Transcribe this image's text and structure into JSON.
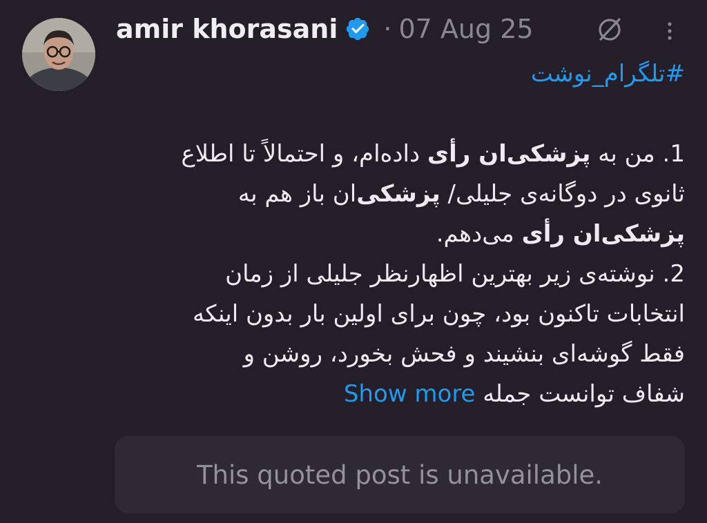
{
  "tweet": {
    "author_name": "amir khorasani",
    "separator": "·",
    "date": "07 Aug 25",
    "hashtag": "#تلگرام_نوشت",
    "lines": [
      [
        {
          "t": "1. من به ",
          "b": false
        },
        {
          "t": "پزشکی‌ان رأی",
          "b": true
        },
        {
          "t": " داده‌ام، و احتمالاً تا اطلاع",
          "b": false
        }
      ],
      [
        {
          "t": "ثانوی در دوگانه‌ی جلیلی/ ",
          "b": false
        },
        {
          "t": "پزشکی‌",
          "b": true
        },
        {
          "t": "ان باز هم به",
          "b": false
        }
      ],
      [
        {
          "t": "پزشکی‌ان رأی",
          "b": true
        },
        {
          "t": " می‌دهم.",
          "b": false
        }
      ],
      [
        {
          "t": "2. نوشته‌ی زیر بهترین اظهارنظر جلیلی از زمان",
          "b": false
        }
      ],
      [
        {
          "t": "انتخابات تاکنون بود، چون برای اولین بار بدون اینکه",
          "b": false
        }
      ],
      [
        {
          "t": "فقط گوشه‌ای بنشیند و فحش بخورد، روشن و",
          "b": false
        }
      ]
    ],
    "last_line": "شفاف توانست جمله",
    "show_more": "Show more",
    "quoted_post": "This quoted post is unavailable."
  },
  "icons": {
    "verified": "verified-badge-icon",
    "grok": "grok-icon",
    "more": "more-vertical-icon"
  },
  "colors": {
    "background": "#231e27",
    "link": "#1d9bf0",
    "muted": "#8b8791",
    "quote_bg": "#2e2933"
  }
}
